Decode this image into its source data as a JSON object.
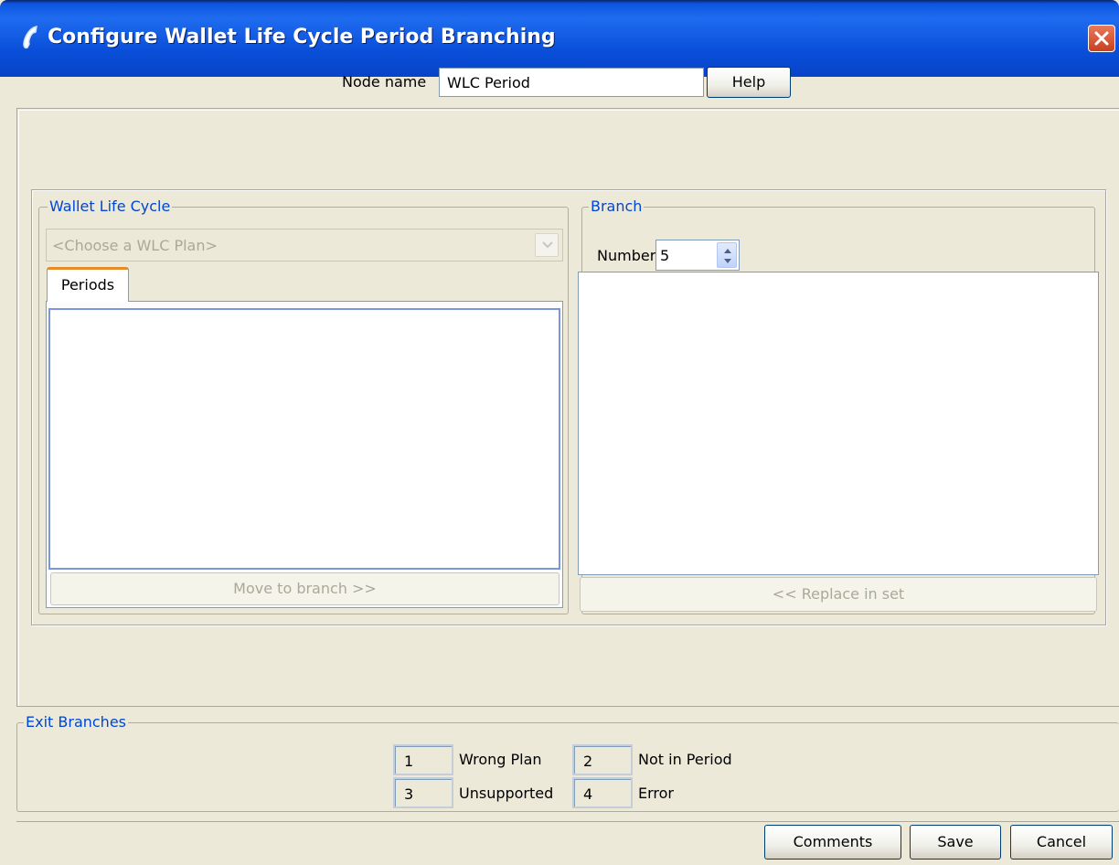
{
  "window": {
    "title": "Configure Wallet Life Cycle Period Branching",
    "icon": "telephone-handset-icon",
    "close_icon": "close-icon"
  },
  "node": {
    "label": "Node name",
    "value": "WLC Period",
    "help_label": "Help"
  },
  "wallet_life_cycle": {
    "legend": "Wallet Life Cycle",
    "plan_placeholder": "<Choose a WLC Plan>",
    "tabs": [
      {
        "label": "Periods",
        "selected": true
      }
    ],
    "periods": [],
    "move_button": "Move to branch >>"
  },
  "branch": {
    "legend": "Branch",
    "number_label": "Number",
    "number_value": "5",
    "items": [],
    "replace_button": "<< Replace in set"
  },
  "exit_branches": {
    "legend": "Exit Branches",
    "items": [
      {
        "number": "1",
        "label": "Wrong Plan"
      },
      {
        "number": "2",
        "label": "Not in Period"
      },
      {
        "number": "3",
        "label": "Unsupported"
      },
      {
        "number": "4",
        "label": "Error"
      }
    ]
  },
  "footer": {
    "comments_label": "Comments",
    "save_label": "Save",
    "cancel_label": "Cancel"
  },
  "colors": {
    "titlebar": "#0b55e0",
    "legend_text": "#0046d5",
    "dialog_bg": "#ece9d8",
    "tab_accent": "#e68b2c"
  }
}
